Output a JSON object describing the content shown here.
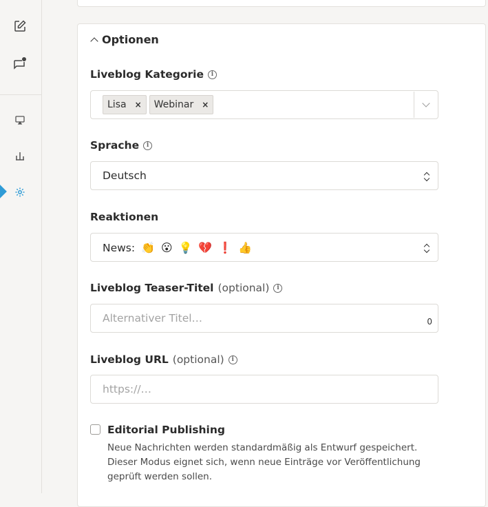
{
  "sidebar": {
    "items": [
      {
        "icon": "edit-icon"
      },
      {
        "icon": "chat-notification-icon"
      },
      {
        "icon": "display-icon"
      },
      {
        "icon": "bar-chart-icon"
      },
      {
        "icon": "gear-icon",
        "active": true
      }
    ],
    "accent_color": "#2f9bd6"
  },
  "options": {
    "title": "Optionen",
    "category": {
      "label": "Liveblog Kategorie",
      "tags": [
        {
          "label": "Lisa"
        },
        {
          "label": "Webinar"
        }
      ],
      "remove_glyph": "×"
    },
    "language": {
      "label": "Sprache",
      "value": "Deutsch"
    },
    "reactions": {
      "label": "Reaktionen",
      "prefix": "News:",
      "emojis": [
        "👏",
        "😮",
        "💡",
        "💔",
        "❗",
        "👍"
      ]
    },
    "teaser": {
      "label": "Liveblog Teaser-Titel",
      "optional": "(optional)",
      "placeholder": "Alternativer Titel…",
      "counter": "0"
    },
    "url": {
      "label": "Liveblog URL",
      "optional": "(optional)",
      "placeholder": "https://…"
    },
    "editorial": {
      "label": "Editorial Publishing",
      "checked": false,
      "description": "Neue Nachrichten werden standardmäßig als Entwurf gespeichert. Dieser Modus eignet sich, wenn neue Einträge vor Veröffentlichung geprüft werden sollen."
    }
  }
}
